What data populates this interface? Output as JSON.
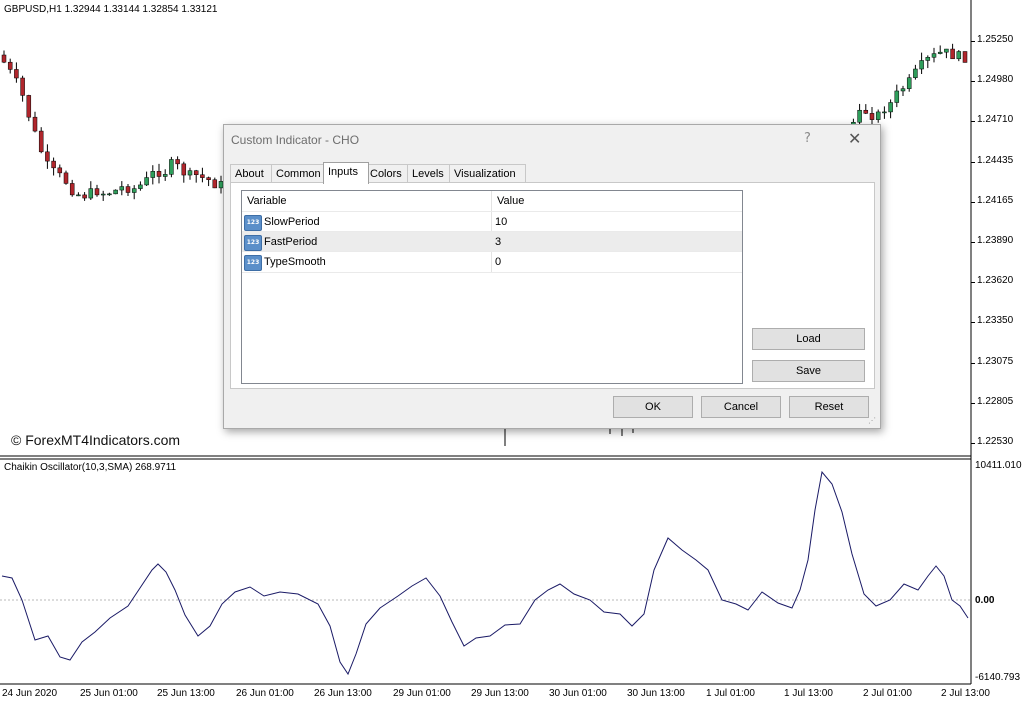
{
  "chart": {
    "header": "GBPUSD,H1  1.32944 1.33144 1.32854 1.33121",
    "price_labels": [
      "1.25250",
      "1.24980",
      "1.24710",
      "1.24435",
      "1.24165",
      "1.23890",
      "1.23620",
      "1.23350",
      "1.23075",
      "1.22805",
      "1.22530"
    ],
    "watermark": "© ForexMT4Indicators.com",
    "colors": {
      "bull": "#2e9e5b",
      "bear": "#b0262c",
      "wick": "#000000",
      "osc_line": "#1a1a66",
      "zero_line": "#b8b8b8"
    }
  },
  "indicator": {
    "header": "Chaikin Oscillator(10,3,SMA) 268.9711",
    "scale_labels": [
      "10411.010",
      "0.00",
      "-6140.793"
    ]
  },
  "time_axis": [
    "24 Jun 2020",
    "25 Jun 01:00",
    "25 Jun 13:00",
    "26 Jun 01:00",
    "26 Jun 13:00",
    "29 Jun 01:00",
    "29 Jun 13:00",
    "30 Jun 01:00",
    "30 Jun 13:00",
    "1 Jul 01:00",
    "1 Jul 13:00",
    "2 Jul 01:00",
    "2 Jul 13:00"
  ],
  "dialog": {
    "title": "Custom Indicator - CHO",
    "help": "?",
    "close": "✕",
    "tabs": [
      "About",
      "Common",
      "Inputs",
      "Colors",
      "Levels",
      "Visualization"
    ],
    "active_tab": "Inputs",
    "table": {
      "headers": [
        "Variable",
        "Value"
      ],
      "rows": [
        {
          "icon": "123",
          "variable": "SlowPeriod",
          "value": "10"
        },
        {
          "icon": "123",
          "variable": "FastPeriod",
          "value": "3"
        },
        {
          "icon": "123",
          "variable": "TypeSmooth",
          "value": "0"
        }
      ]
    },
    "buttons": {
      "load": "Load",
      "save": "Save",
      "ok": "OK",
      "cancel": "Cancel",
      "reset": "Reset"
    }
  }
}
